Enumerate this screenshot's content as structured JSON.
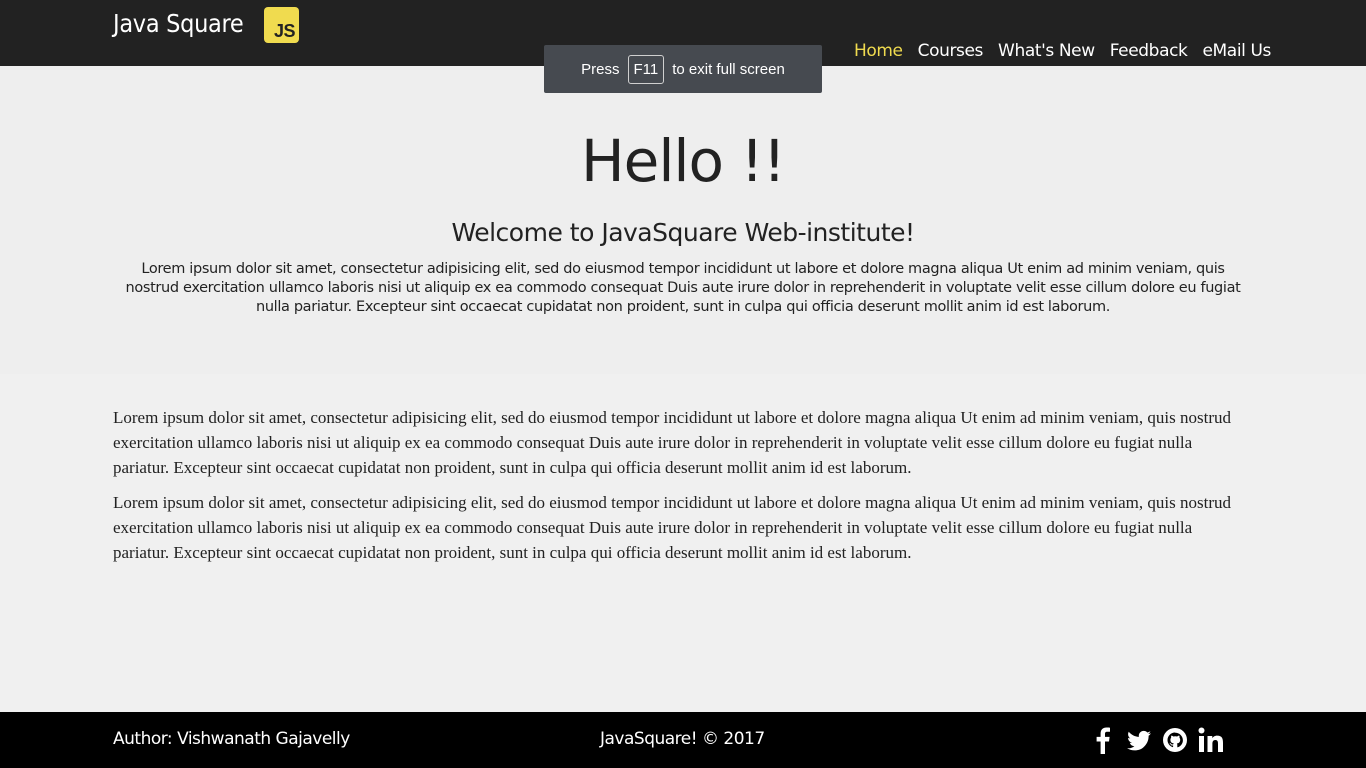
{
  "header": {
    "brand": "Java Square",
    "logo_text": "JS",
    "nav": [
      {
        "label": "Home",
        "active": true
      },
      {
        "label": "Courses"
      },
      {
        "label": "What's New"
      },
      {
        "label": "Feedback"
      },
      {
        "label": "eMail Us"
      }
    ]
  },
  "fullscreen_toast": {
    "prefix": "Press",
    "key": "F11",
    "suffix": "to exit full screen"
  },
  "hero": {
    "title": "Hello !!",
    "subtitle": "Welcome to JavaSquare Web-institute!",
    "text": "Lorem ipsum dolor sit amet, consectetur adipisicing elit, sed do eiusmod tempor incididunt ut labore et dolore magna aliqua Ut enim ad minim veniam, quis nostrud exercitation ullamco laboris nisi ut aliquip ex ea commodo consequat Duis aute irure dolor in reprehenderit in voluptate velit esse cillum dolore eu fugiat nulla pariatur. Excepteur sint occaecat cupidatat non proident, sunt in culpa qui officia deserunt mollit anim id est laborum."
  },
  "content": {
    "paragraphs": [
      "Lorem ipsum dolor sit amet, consectetur adipisicing elit, sed do eiusmod tempor incididunt ut labore et dolore magna aliqua Ut enim ad minim veniam, quis nostrud exercitation ullamco laboris nisi ut aliquip ex ea commodo consequat Duis aute irure dolor in reprehenderit in voluptate velit esse cillum dolore eu fugiat nulla pariatur. Excepteur sint occaecat cupidatat non proident, sunt in culpa qui officia deserunt mollit anim id est laborum.",
      "Lorem ipsum dolor sit amet, consectetur adipisicing elit, sed do eiusmod tempor incididunt ut labore et dolore magna aliqua Ut enim ad minim veniam, quis nostrud exercitation ullamco laboris nisi ut aliquip ex ea commodo consequat Duis aute irure dolor in reprehenderit in voluptate velit esse cillum dolore eu fugiat nulla pariatur. Excepteur sint occaecat cupidatat non proident, sunt in culpa qui officia deserunt mollit anim id est laborum."
    ]
  },
  "footer": {
    "author": "Author: Vishwanath Gajavelly",
    "copyright": "JavaSquare! © 2017",
    "social_icons": [
      "facebook-icon",
      "twitter-icon",
      "github-icon",
      "linkedin-icon"
    ]
  },
  "colors": {
    "header_bg": "#222222",
    "accent": "#f0db4f",
    "hero_bg": "#eeeeee",
    "body_bg": "#f0f0f0",
    "footer_bg": "#000000"
  }
}
